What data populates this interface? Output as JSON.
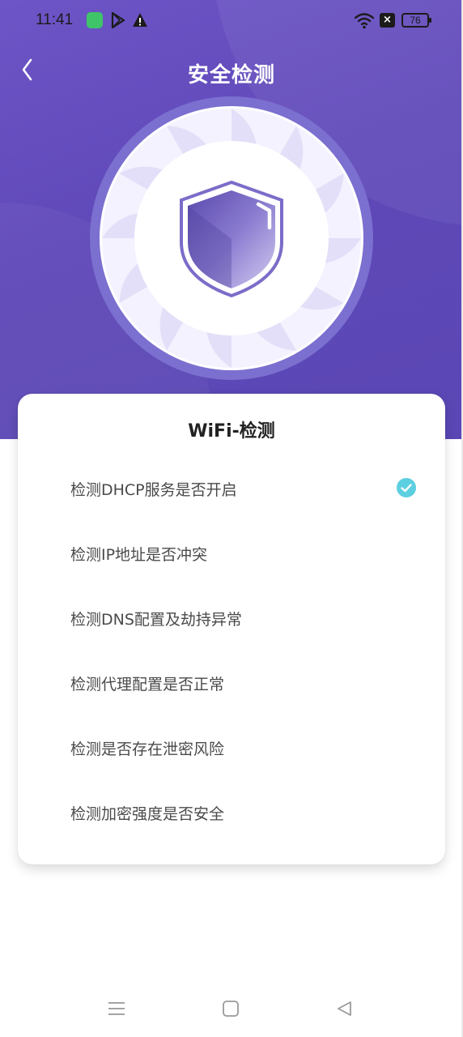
{
  "status_bar": {
    "time": "11:41",
    "battery": "76",
    "icons": [
      "app-icon",
      "play-store-icon",
      "warning-icon",
      "wifi-icon",
      "close-box-icon",
      "battery-icon"
    ]
  },
  "header": {
    "title": "安全检测",
    "back_icon": "chevron-left-icon"
  },
  "hero": {
    "graphic": "shield-fan-icon",
    "accent": "#5f48b8"
  },
  "card": {
    "title": "WiFi-检测",
    "items": [
      {
        "label": "检测DHCP服务是否开启",
        "checked": true
      },
      {
        "label": "检测IP地址是否冲突",
        "checked": false
      },
      {
        "label": "检测DNS配置及劫持异常",
        "checked": false
      },
      {
        "label": "检测代理配置是否正常",
        "checked": false
      },
      {
        "label": "检测是否存在泄密风险",
        "checked": false
      },
      {
        "label": "检测加密强度是否安全",
        "checked": false
      }
    ],
    "check_color": "#5ccfe0"
  },
  "nav_bar": {
    "icons": [
      "menu-icon",
      "home-square-icon",
      "back-triangle-icon"
    ]
  }
}
